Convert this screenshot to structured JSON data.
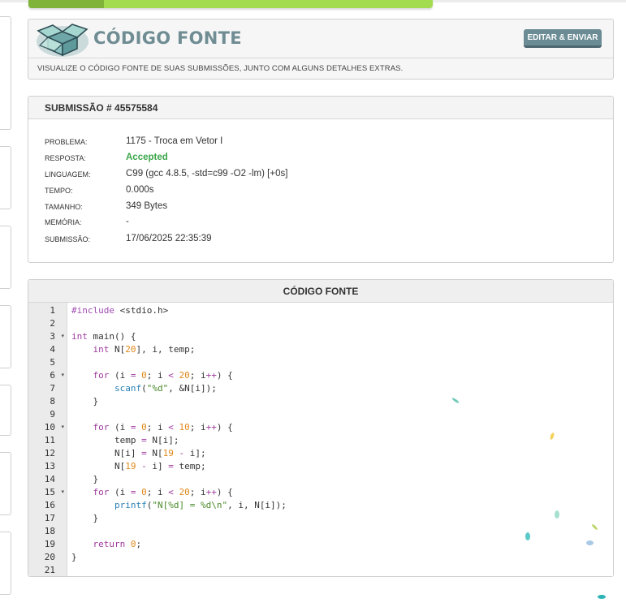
{
  "header": {
    "title": "CÓDIGO FONTE",
    "edit_button": "EDITAR & ENVIAR",
    "subtitle": "VISUALIZE O CÓDIGO FONTE DE SUAS SUBMISSÕES, JUNTO COM ALGUNS DETALHES EXTRAS.",
    "logo_icon": "open-box-icon"
  },
  "submission": {
    "title": "SUBMISSÃO # 45575584",
    "rows": [
      {
        "label": "PROBLEMA:",
        "value": "1175 - Troca em Vetor I"
      },
      {
        "label": "RESPOSTA:",
        "value": "Accepted"
      },
      {
        "label": "LINGUAGEM:",
        "value": "C99 (gcc 4.8.5, -std=c99 -O2 -lm) [+0s]"
      },
      {
        "label": "TEMPO:",
        "value": "0.000s"
      },
      {
        "label": "TAMANHO:",
        "value": "349 Bytes"
      },
      {
        "label": "MEMÓRIA:",
        "value": "-"
      },
      {
        "label": "SUBMISSÃO:",
        "value": "17/06/2025 22:35:39"
      }
    ],
    "accepted_color": "#3aa54a"
  },
  "code": {
    "title": "CÓDIGO FONTE",
    "lines": [
      "#include <stdio.h>",
      "",
      "int main() {",
      "    int N[20], i, temp;",
      "",
      "    for (i = 0; i < 20; i++) {",
      "        scanf(\"%d\", &N[i]);",
      "    }",
      "",
      "    for (i = 0; i < 10; i++) {",
      "        temp = N[i];",
      "        N[i] = N[19 - i];",
      "        N[19 - i] = temp;",
      "    }",
      "    for (i = 0; i < 20; i++) {",
      "        printf(\"N[%d] = %d\\n\", i, N[i]);",
      "    }",
      "",
      "    return 0;",
      "}",
      ""
    ],
    "line_numbers": [
      "1",
      "2",
      "3",
      "4",
      "5",
      "6",
      "7",
      "8",
      "9",
      "10",
      "11",
      "12",
      "13",
      "14",
      "15",
      "16",
      "17",
      "18",
      "19",
      "20",
      "21"
    ],
    "fold_lines": [
      3,
      6,
      10,
      15
    ]
  }
}
